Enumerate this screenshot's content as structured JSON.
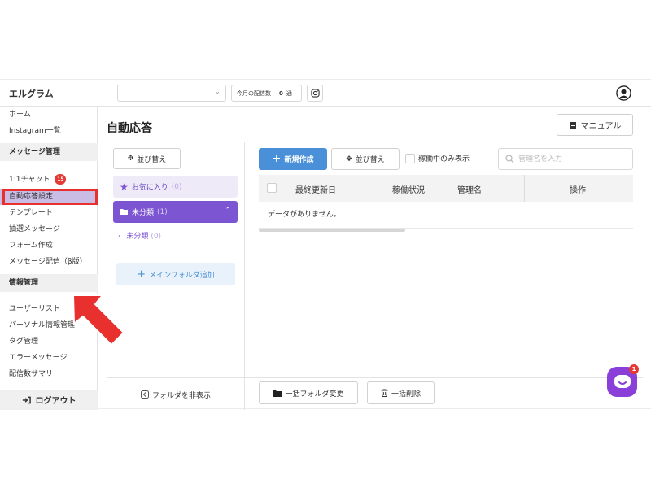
{
  "header": {
    "brand": "エルグラム",
    "monthly_label": "今月の配信数",
    "monthly_count": "0",
    "monthly_unit": "通"
  },
  "sidebar": {
    "items_top": [
      {
        "label": "ホーム"
      },
      {
        "label": "Instagram一覧"
      }
    ],
    "section_message": "メッセージ管理",
    "chat_label": "1:1チャット",
    "chat_badge": "15",
    "message_items": [
      {
        "label": "自動応答設定",
        "active": true
      },
      {
        "label": "テンプレート"
      },
      {
        "label": "抽選メッセージ"
      },
      {
        "label": "フォーム作成"
      },
      {
        "label": "メッセージ配信（β版）"
      }
    ],
    "section_info": "情報管理",
    "info_items": [
      {
        "label": "ユーザーリスト"
      },
      {
        "label": "パーソナル情報管理"
      },
      {
        "label": "タグ管理"
      },
      {
        "label": "エラーメッセージ"
      },
      {
        "label": "配信数サマリー"
      }
    ],
    "logout": "ログアウト"
  },
  "main": {
    "title": "自動応答",
    "manual_button": "マニュアル"
  },
  "folders": {
    "sort_button": "並び替え",
    "favorites_label": "お気に入り",
    "favorites_count": "(0)",
    "uncategorized_label": "未分類",
    "uncategorized_count": "(1)",
    "child_label": "未分類",
    "child_count": "(0)",
    "add_main_folder": "メインフォルダ追加",
    "hide_folders": "フォルダを非表示"
  },
  "toolbar": {
    "new_button": "新規作成",
    "sort_button": "並び替え",
    "active_only": "稼働中のみ表示",
    "search_placeholder": "管理名を入力"
  },
  "table": {
    "columns": [
      "最終更新日",
      "稼働状況",
      "管理名",
      "操作"
    ],
    "empty_message": "データがありません。"
  },
  "bulk": {
    "folder_change": "一括フォルダ変更",
    "delete": "一括削除"
  },
  "chat_widget": {
    "badge": "1"
  },
  "colors": {
    "accent_purple": "#7b55d2",
    "primary_blue": "#4a90d9",
    "annotation_red": "#e8302e"
  }
}
